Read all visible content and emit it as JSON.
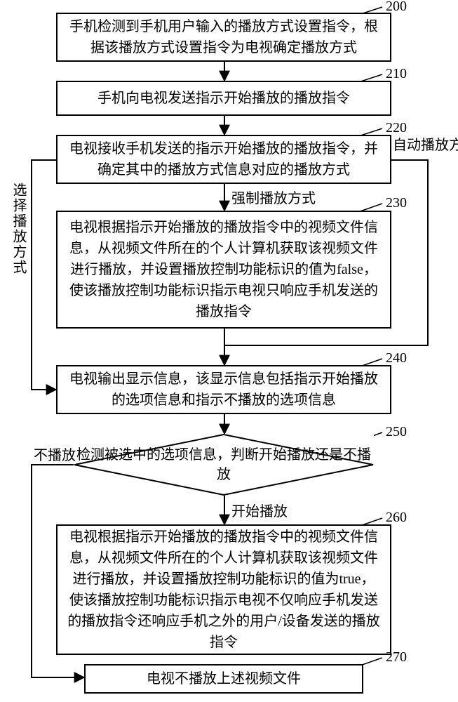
{
  "chart_data": {
    "type": "flowchart",
    "nodes": [
      {
        "id": 200,
        "shape": "process",
        "text": "手机检测到手机用户输入的播放方式设置指令，根据该播放方式设置指令为电视确定播放方式"
      },
      {
        "id": 210,
        "shape": "process",
        "text": "手机向电视发送指示开始播放的播放指令"
      },
      {
        "id": 220,
        "shape": "process",
        "text": "电视接收手机发送的指示开始播放的播放指令，并确定其中的播放方式信息对应的播放方式"
      },
      {
        "id": 230,
        "shape": "process",
        "text": "电视根据指示开始播放的播放指令中的视频文件信息，从视频文件所在的个人计算机获取该视频文件进行播放，并设置播放控制功能标识的值为false，使该播放控制功能标识指示电视只响应手机发送的播放指令"
      },
      {
        "id": 240,
        "shape": "process",
        "text": "电视输出显示信息，该显示信息包括指示开始播放的选项信息和指示不播放的选项信息"
      },
      {
        "id": 250,
        "shape": "decision",
        "text": "检测被选中的选项信息，判断开始播放还是不播放"
      },
      {
        "id": 260,
        "shape": "process",
        "text": "电视根据指示开始播放的播放指令中的视频文件信息，从视频文件所在的个人计算机获取该视频文件进行播放，并设置播放控制功能标识的值为true，使该播放控制功能标识指示电视不仅响应手机发送的播放指令还响应手机之外的用户/设备发送的播放指令"
      },
      {
        "id": 270,
        "shape": "process",
        "text": "电视不播放上述视频文件"
      }
    ],
    "edges": [
      {
        "from": 200,
        "to": 210,
        "label": ""
      },
      {
        "from": 210,
        "to": 220,
        "label": ""
      },
      {
        "from": 220,
        "to": 230,
        "label": "强制播放方式"
      },
      {
        "from": 220,
        "to": 240,
        "label": "选择播放方式",
        "path": "left"
      },
      {
        "from": 220,
        "to": 230,
        "label": "自动播放方式",
        "path": "right-bypass",
        "note": "goes around 230 to merge before 240"
      },
      {
        "from": 230,
        "to": 240,
        "label": ""
      },
      {
        "from": 240,
        "to": 250,
        "label": ""
      },
      {
        "from": 250,
        "to": 260,
        "label": "开始播放"
      },
      {
        "from": 250,
        "to": 270,
        "label": "不播放",
        "path": "left"
      }
    ]
  },
  "boxes": {
    "b200": "手机检测到手机用户输入的播放方式设置指令，根据该播放方式设置指令为电视确定播放方式",
    "b210": "手机向电视发送指示开始播放的播放指令",
    "b220": "电视接收手机发送的指示开始播放的播放指令，并确定其中的播放方式信息对应的播放方式",
    "b230": "电视根据指示开始播放的播放指令中的视频文件信息，从视频文件所在的个人计算机获取该视频文件进行播放，并设置播放控制功能标识的值为false，使该播放控制功能标识指示电视只响应手机发送的播放指令",
    "b240": "电视输出显示信息，该显示信息包括指示开始播放的选项信息和指示不播放的选项信息",
    "b250": "检测被选中的选项信息，判断开始播放还是不播放",
    "b260": "电视根据指示开始播放的播放指令中的视频文件信息，从视频文件所在的个人计算机获取该视频文件进行播放，并设置播放控制功能标识的值为true，使该播放控制功能标识指示电视不仅响应手机发送的播放指令还响应手机之外的用户/设备发送的播放指令",
    "b270": "电视不播放上述视频文件"
  },
  "labels": {
    "select_mode": "选择播放方式",
    "force_mode": "强制播放方式",
    "auto_mode": "自动播放方式",
    "no_play": "不播放",
    "start_play": "开始播放"
  },
  "refs": {
    "r200": "200",
    "r210": "210",
    "r220": "220",
    "r230": "230",
    "r240": "240",
    "r250": "250",
    "r260": "260",
    "r270": "270"
  }
}
